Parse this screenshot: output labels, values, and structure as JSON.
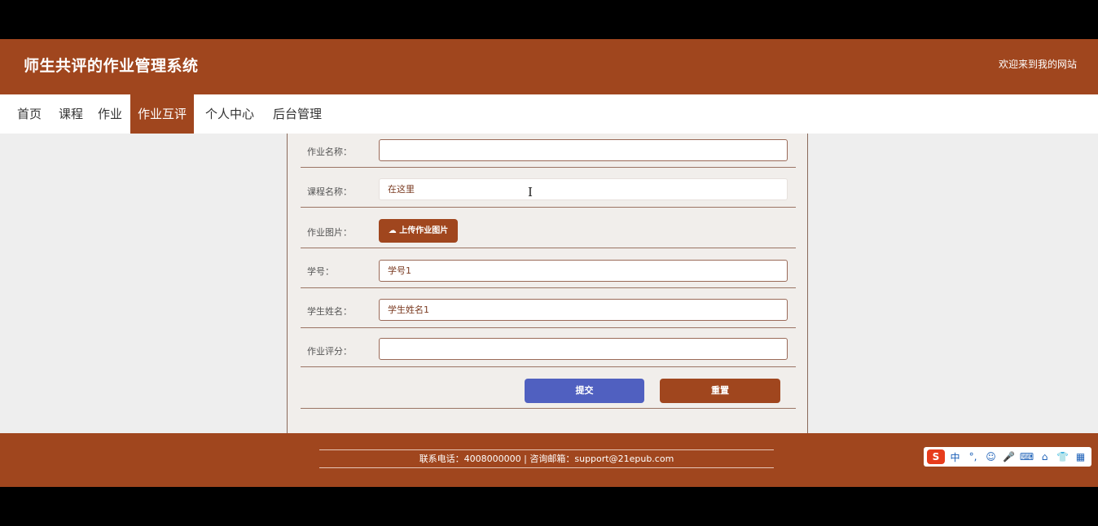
{
  "header": {
    "title": "师生共评的作业管理系统",
    "welcome": "欢迎来到我的网站"
  },
  "nav": {
    "items": [
      {
        "label": "首页"
      },
      {
        "label": "课程"
      },
      {
        "label": "作业"
      },
      {
        "label": "作业互评"
      },
      {
        "label": "个人中心"
      },
      {
        "label": "后台管理"
      }
    ],
    "active": "作业互评"
  },
  "form": {
    "fields": [
      {
        "label": "作业名称：",
        "value": ""
      },
      {
        "label": "课程名称：",
        "value": "在这里"
      },
      {
        "label": "作业图片：",
        "button": "上传作业图片"
      },
      {
        "label": "学号：",
        "value": "学号1"
      },
      {
        "label": "学生姓名：",
        "value": "学生姓名1"
      },
      {
        "label": "作业评分：",
        "value": ""
      }
    ],
    "submit_label": "提交",
    "reset_label": "重置"
  },
  "footer": {
    "contact": "联系电话：4008000000 | 咨询邮箱：support@21epub.com"
  },
  "ime": {
    "logo": "S",
    "items": [
      "中",
      "°,",
      "☺",
      "🎤",
      "⌨",
      "⌂",
      "👕",
      "▦"
    ]
  },
  "colors": {
    "brand": "#a0461e",
    "submit": "#5060c0"
  }
}
